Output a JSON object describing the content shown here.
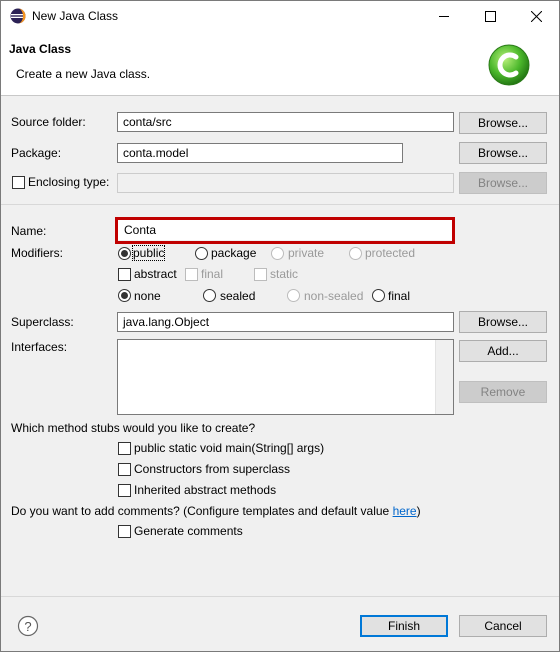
{
  "window": {
    "title": "New Java Class"
  },
  "banner": {
    "title": "Java Class",
    "description": "Create a new Java class."
  },
  "source_folder": {
    "label": "Source folder:",
    "value": "conta/src",
    "browse": "Browse..."
  },
  "package": {
    "label": "Package:",
    "value": "conta.model",
    "browse": "Browse..."
  },
  "enclosing_type": {
    "label": "Enclosing type:",
    "value": "",
    "browse": "Browse..."
  },
  "name": {
    "label": "Name:",
    "value": "Conta"
  },
  "modifiers": {
    "label": "Modifiers:",
    "access": [
      "public",
      "package",
      "private",
      "protected"
    ],
    "access_selected": "public",
    "flags": [
      "abstract",
      "final",
      "static"
    ],
    "sealing": [
      "none",
      "sealed",
      "non-sealed",
      "final"
    ],
    "sealing_selected": "none"
  },
  "superclass": {
    "label": "Superclass:",
    "value": "java.lang.Object",
    "browse": "Browse..."
  },
  "interfaces": {
    "label": "Interfaces:",
    "add": "Add...",
    "remove": "Remove"
  },
  "stubs": {
    "question": "Which method stubs would you like to create?",
    "options": [
      "public static void main(String[] args)",
      "Constructors from superclass",
      "Inherited abstract methods"
    ]
  },
  "comments": {
    "question": "Do you want to add comments? (Configure templates and default value ",
    "link": "here",
    "question_end": ")",
    "option": "Generate comments"
  },
  "footer": {
    "finish": "Finish",
    "cancel": "Cancel"
  },
  "colors": {
    "highlight": "#c00000",
    "link": "#0066cc",
    "default_button": "#0078d7"
  }
}
